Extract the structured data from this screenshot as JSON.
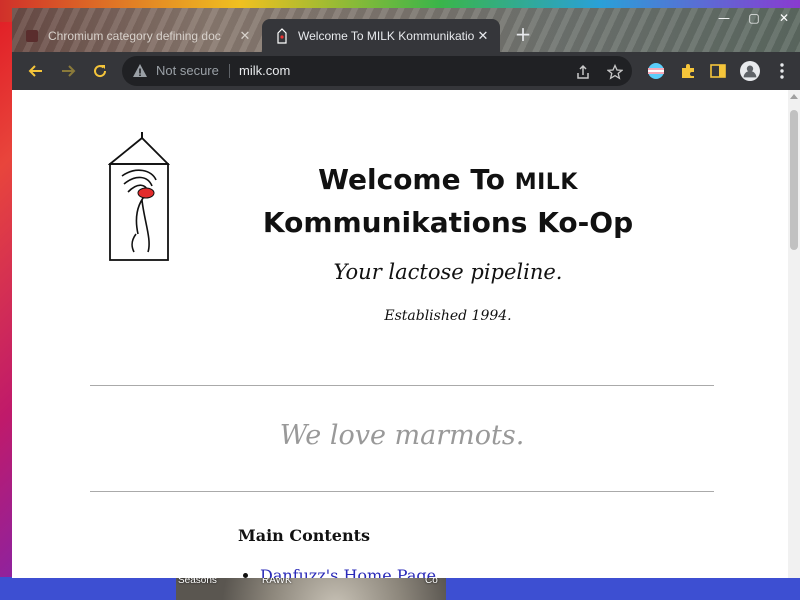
{
  "browser": {
    "tabs": [
      {
        "title": "Chromium category defining doc",
        "active": false
      },
      {
        "title": "Welcome To MILK Kommunikatio",
        "active": true
      }
    ],
    "omnibox": {
      "security_text": "Not secure",
      "url": "milk.com"
    }
  },
  "page": {
    "heading_part1": "Welcome To",
    "heading_smallcaps": "MILK",
    "heading_part2": "Kommunikations Ko-Op",
    "tagline": "Your lactose pipeline.",
    "established": "Established 1994.",
    "slogan": "We love marmots.",
    "main_contents_heading": "Main Contents",
    "links": [
      "Danfuzz's Home Page"
    ]
  },
  "desktop": {
    "labels": [
      "Seasons",
      "RAWK",
      "Co"
    ]
  },
  "colors": {
    "link": "#2a2ab8",
    "slogan": "#999999",
    "tab_active": "#35363a",
    "toolbar": "#35363a"
  }
}
